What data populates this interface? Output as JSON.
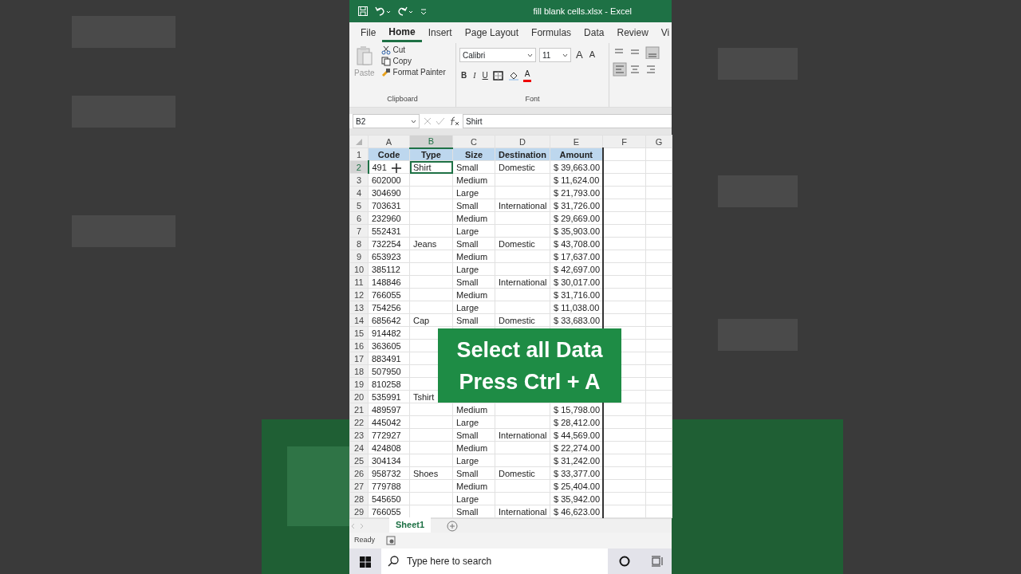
{
  "window": {
    "title": "fill blank cells.xlsx  -  Excel"
  },
  "ribbon_tabs": [
    {
      "label": "File",
      "selected": false
    },
    {
      "label": "Home",
      "selected": true
    },
    {
      "label": "Insert",
      "selected": false
    },
    {
      "label": "Page Layout",
      "selected": false
    },
    {
      "label": "Formulas",
      "selected": false
    },
    {
      "label": "Data",
      "selected": false
    },
    {
      "label": "Review",
      "selected": false
    },
    {
      "label": "Vi",
      "selected": false
    }
  ],
  "clipboard": {
    "paste": "Paste",
    "cut": "Cut",
    "copy": "Copy",
    "format_painter": "Format Painter",
    "group_label": "Clipboard"
  },
  "font": {
    "name": "Calibri",
    "size": "11",
    "grow": "A",
    "shrink": "A",
    "bold": "B",
    "italic": "I",
    "underline": "U",
    "font_color": "A",
    "group_label": "Font"
  },
  "formula_bar": {
    "name_box": "B2",
    "value": "Shirt"
  },
  "columns": [
    {
      "label": "A",
      "selected": false
    },
    {
      "label": "B",
      "selected": true
    },
    {
      "label": "C",
      "selected": false
    },
    {
      "label": "D",
      "selected": false
    },
    {
      "label": "E",
      "selected": false
    },
    {
      "label": "F",
      "selected": false
    },
    {
      "label": "G",
      "selected": false
    }
  ],
  "rows": [
    {
      "number": "1",
      "selected": false,
      "kind": "header",
      "code": "Code",
      "type": "Type",
      "size": "Size",
      "destination": "Destination",
      "amount": "Amount"
    },
    {
      "number": "2",
      "selected": true,
      "kind": "data",
      "code": "491",
      "type": "Shirt",
      "size": "Small",
      "destination": "Domestic",
      "amount": "$ 39,663.00"
    },
    {
      "number": "3",
      "selected": false,
      "kind": "data",
      "code": "602000",
      "size": "Medium",
      "amount": "$ 11,624.00"
    },
    {
      "number": "4",
      "selected": false,
      "kind": "data",
      "code": "304690",
      "size": "Large",
      "amount": "$ 21,793.00"
    },
    {
      "number": "5",
      "selected": false,
      "kind": "data",
      "code": "703631",
      "size": "Small",
      "destination": "International",
      "amount": "$ 31,726.00"
    },
    {
      "number": "6",
      "selected": false,
      "kind": "data",
      "code": "232960",
      "size": "Medium",
      "amount": "$ 29,669.00"
    },
    {
      "number": "7",
      "selected": false,
      "kind": "data",
      "code": "552431",
      "size": "Large",
      "amount": "$ 35,903.00"
    },
    {
      "number": "8",
      "selected": false,
      "kind": "data",
      "code": "732254",
      "type": "Jeans",
      "size": "Small",
      "destination": "Domestic",
      "amount": "$ 43,708.00"
    },
    {
      "number": "9",
      "selected": false,
      "kind": "data",
      "code": "653923",
      "size": "Medium",
      "amount": "$ 17,637.00"
    },
    {
      "number": "10",
      "selected": false,
      "kind": "data",
      "code": "385112",
      "size": "Large",
      "amount": "$ 42,697.00"
    },
    {
      "number": "11",
      "selected": false,
      "kind": "data",
      "code": "148846",
      "size": "Small",
      "destination": "International",
      "amount": "$ 30,017.00"
    },
    {
      "number": "12",
      "selected": false,
      "kind": "data",
      "code": "766055",
      "size": "Medium",
      "amount": "$ 31,716.00"
    },
    {
      "number": "13",
      "selected": false,
      "kind": "data",
      "code": "754256",
      "size": "Large",
      "amount": "$ 11,038.00"
    },
    {
      "number": "14",
      "selected": false,
      "kind": "data",
      "code": "685642",
      "type": "Cap",
      "size": "Small",
      "destination": "Domestic",
      "amount": "$ 33,683.00"
    },
    {
      "number": "15",
      "selected": false,
      "kind": "data",
      "code": "914482"
    },
    {
      "number": "16",
      "selected": false,
      "kind": "data",
      "code": "363605"
    },
    {
      "number": "17",
      "selected": false,
      "kind": "data",
      "code": "883491"
    },
    {
      "number": "18",
      "selected": false,
      "kind": "data",
      "code": "507950"
    },
    {
      "number": "19",
      "selected": false,
      "kind": "data",
      "code": "810258"
    },
    {
      "number": "20",
      "selected": false,
      "kind": "data",
      "code": "535991",
      "type": "Tshirt"
    },
    {
      "number": "21",
      "selected": false,
      "kind": "data",
      "code": "489597",
      "size": "Medium",
      "amount": "$ 15,798.00"
    },
    {
      "number": "22",
      "selected": false,
      "kind": "data",
      "code": "445042",
      "size": "Large",
      "amount": "$ 28,412.00"
    },
    {
      "number": "23",
      "selected": false,
      "kind": "data",
      "code": "772927",
      "size": "Small",
      "destination": "International",
      "amount": "$ 44,569.00"
    },
    {
      "number": "24",
      "selected": false,
      "kind": "data",
      "code": "424808",
      "size": "Medium",
      "amount": "$ 22,274.00"
    },
    {
      "number": "25",
      "selected": false,
      "kind": "data",
      "code": "304134",
      "size": "Large",
      "amount": "$ 31,242.00"
    },
    {
      "number": "26",
      "selected": false,
      "kind": "data",
      "code": "958732",
      "type": "Shoes",
      "size": "Small",
      "destination": "Domestic",
      "amount": "$ 33,377.00"
    },
    {
      "number": "27",
      "selected": false,
      "kind": "data",
      "code": "779788",
      "size": "Medium",
      "amount": "$ 25,404.00"
    },
    {
      "number": "28",
      "selected": false,
      "kind": "data",
      "code": "545650",
      "size": "Large",
      "amount": "$ 35,942.00"
    },
    {
      "number": "29",
      "selected": false,
      "kind": "data",
      "code": "766055",
      "size": "Small",
      "destination": "International",
      "amount": "$ 46,623.00"
    }
  ],
  "overlay": {
    "lines": [
      "Select all Data",
      "Press Ctrl + A"
    ]
  },
  "sheets": [
    {
      "label": "Sheet1",
      "selected": true
    }
  ],
  "status_bar": {
    "text": "Ready"
  },
  "taskbar": {
    "search_placeholder": "Type here to search"
  }
}
